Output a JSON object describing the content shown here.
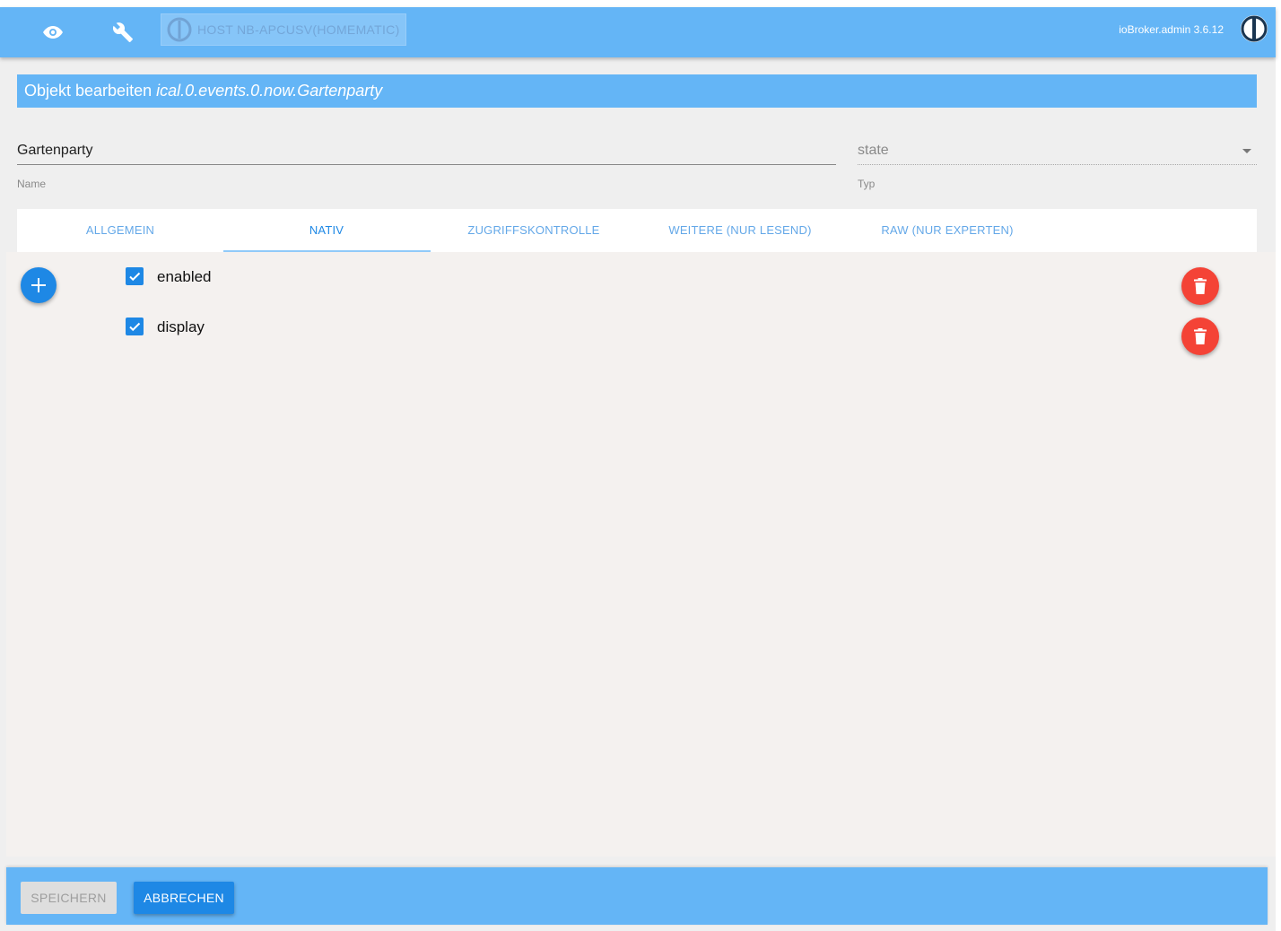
{
  "header": {
    "visibility_icon": "eye-icon",
    "settings_icon": "wrench-icon",
    "host_label": "HOST NB-APCUSV(HOMEMATIC)",
    "version": "ioBroker.admin 3.6.12",
    "logo": "iobroker-logo"
  },
  "dialog": {
    "title_prefix": "Objekt bearbeiten",
    "object_id": "ical.0.events.0.now.Gartenparty",
    "name_value": "Gartenparty",
    "name_label": "Name",
    "type_value": "state",
    "type_label": "Typ"
  },
  "tabs": [
    {
      "label": "ALLGEMEIN",
      "active": false
    },
    {
      "label": "NATIV",
      "active": true
    },
    {
      "label": "ZUGRIFFSKONTROLLE",
      "active": false
    },
    {
      "label": "WEITERE (NUR LESEND)",
      "active": false
    },
    {
      "label": "RAW (NUR EXPERTEN)",
      "active": false
    }
  ],
  "native": {
    "add_icon": "plus-icon",
    "delete_icon": "trash-icon",
    "items": [
      {
        "label": "enabled",
        "checked": true
      },
      {
        "label": "display",
        "checked": true
      }
    ]
  },
  "footer": {
    "save_label": "SPEICHERN",
    "cancel_label": "ABBRECHEN"
  },
  "colors": {
    "primary": "#64b5f6",
    "accent": "#1e88e5",
    "danger": "#f44336"
  }
}
